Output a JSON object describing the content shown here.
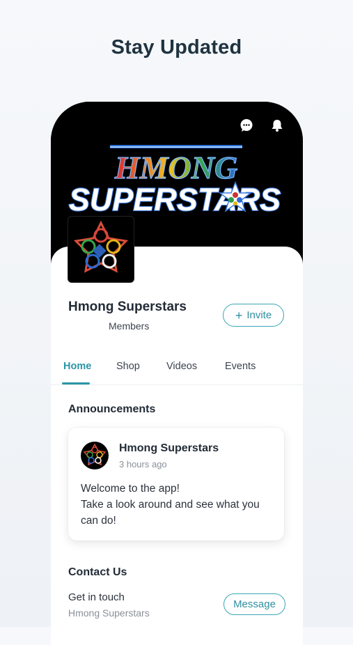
{
  "page": {
    "headline": "Stay Updated"
  },
  "header": {
    "chat_icon": "chat-bubble-icon",
    "bell_icon": "bell-icon"
  },
  "cover": {
    "line1": "HMONG",
    "line2": "SUPERSTARS"
  },
  "group": {
    "name": "Hmong Superstars",
    "members_label": "Members",
    "invite_label": "Invite"
  },
  "tabs": [
    {
      "label": "Home",
      "active": true
    },
    {
      "label": "Shop"
    },
    {
      "label": "Videos"
    },
    {
      "label": "Events"
    }
  ],
  "announcements": {
    "title": "Announcements",
    "post": {
      "author": "Hmong Superstars",
      "time": "3 hours ago",
      "lines": [
        "Welcome to the app!",
        "Take a look around and see what you",
        "can do!"
      ]
    }
  },
  "contact": {
    "title": "Contact Us",
    "line": "Get in touch",
    "sub": "Hmong Superstars",
    "button": "Message"
  },
  "colors": {
    "accent": "#2a95a6",
    "headline": "#1f3340",
    "cover_bg": "#000000"
  }
}
